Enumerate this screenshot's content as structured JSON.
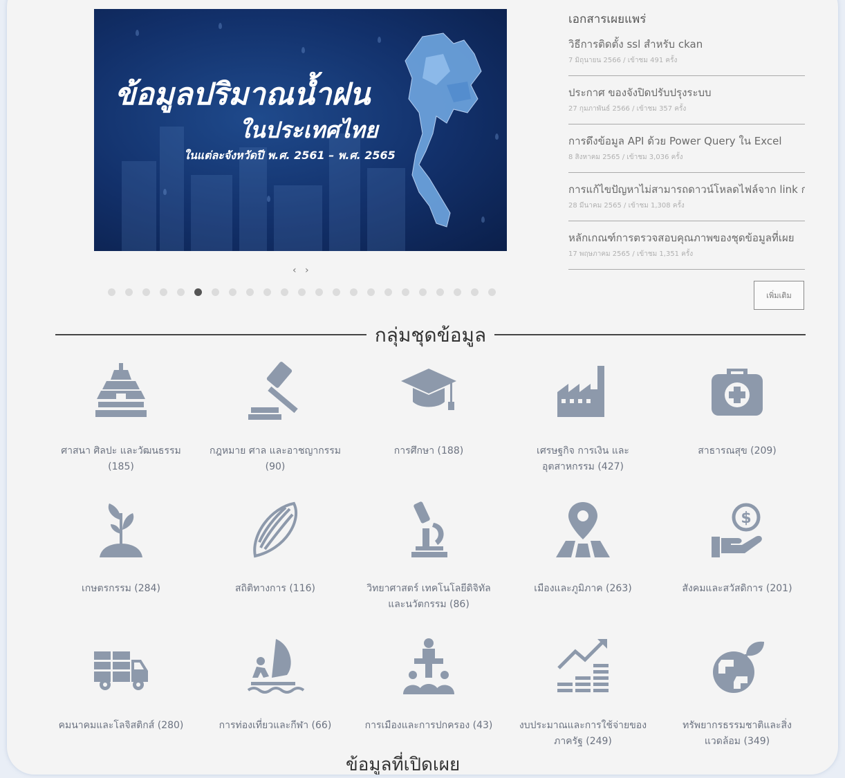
{
  "banner": {
    "title_line1": "ข้อมูลปริมาณน้ำฝน",
    "title_line2": "ในประเทศไทย",
    "title_line3": "ในแต่ละจังหวัดปี พ.ศ. 2561 – พ.ศ. 2565"
  },
  "carousel": {
    "arrows": "‹ ›",
    "dot_count": 23,
    "active_dot": 5
  },
  "publications": {
    "heading": "เอกสารเผยแพร่",
    "items": [
      {
        "title": "วิธีการติดตั้ง ssl สำหรับ ckan",
        "meta": "7 มิถุนายน 2566 / เข้าชม 491 ครั้ง"
      },
      {
        "title": "ประกาศ ของจังปิดปรับปรุงระบบ",
        "meta": "27 กุมภาพันธ์ 2566 / เข้าชม 357 ครั้ง"
      },
      {
        "title": "การดึงข้อมูล API ด้วย Power Query ใน Excel",
        "meta": "8 สิงหาคม 2565 / เข้าชม 3,036 ครั้ง"
      },
      {
        "title": "การแก้ไขปัญหาไม่สามารถดาวน์โหลดไฟล์จาก link ก",
        "meta": "28 มีนาคม 2565 / เข้าชม 1,308 ครั้ง"
      },
      {
        "title": "หลักเกณฑ์การตรวจสอบคุณภาพของชุดข้อมูลที่เผย",
        "meta": "17 พฤษภาคม 2565 / เข้าชม 1,351 ครั้ง"
      }
    ],
    "more_label": "เพิ่มเติม"
  },
  "section": {
    "title": "กลุ่มชุดข้อมูล"
  },
  "categories": [
    {
      "icon": "temple-icon",
      "label1": "ศาสนา ศิลปะ และวัฒนธรรม",
      "label2": "(185)"
    },
    {
      "icon": "gavel-icon",
      "label1": "กฎหมาย ศาล และอาชญากรรม",
      "label2": "(90)"
    },
    {
      "icon": "graduation-cap-icon",
      "label1": "การศึกษา (188)",
      "label2": ""
    },
    {
      "icon": "factory-icon",
      "label1": "เศรษฐกิจ การเงิน และ",
      "label2": "อุตสาหกรรม (427)"
    },
    {
      "icon": "medical-kit-icon",
      "label1": "สาธารณสุข (209)",
      "label2": ""
    },
    {
      "icon": "plant-icon",
      "label1": "เกษตรกรรม (284)",
      "label2": ""
    },
    {
      "icon": "feather-icon",
      "label1": "สถิติทางการ (116)",
      "label2": ""
    },
    {
      "icon": "microscope-icon",
      "label1": "วิทยาศาสตร์ เทคโนโลยีดิจิทัล",
      "label2": "และนวัตกรรม (86)"
    },
    {
      "icon": "map-pin-icon",
      "label1": "เมืองและภูมิภาค (263)",
      "label2": ""
    },
    {
      "icon": "money-hand-icon",
      "label1": "สังคมและสวัสดิการ (201)",
      "label2": ""
    },
    {
      "icon": "truck-icon",
      "label1": "คมนาคมและโลจิสติกส์ (280)",
      "label2": ""
    },
    {
      "icon": "windsurf-icon",
      "label1": "การท่องเที่ยวและกีฬา (66)",
      "label2": ""
    },
    {
      "icon": "government-icon",
      "label1": "การเมืองและการปกครอง (43)",
      "label2": ""
    },
    {
      "icon": "budget-chart-icon",
      "label1": "งบประมาณและการใช้จ่ายของ",
      "label2": "ภาครัฐ (249)"
    },
    {
      "icon": "earth-plant-icon",
      "label1": "ทรัพยากรธรรมชาติและสิ่ง",
      "label2": "แวดล้อม (349)"
    }
  ],
  "bottom": {
    "partial_heading": "ข้อมูลที่เปิดเผย"
  },
  "colors": {
    "icon_gray": "#8d99ab",
    "banner_blue": "#12306a"
  }
}
